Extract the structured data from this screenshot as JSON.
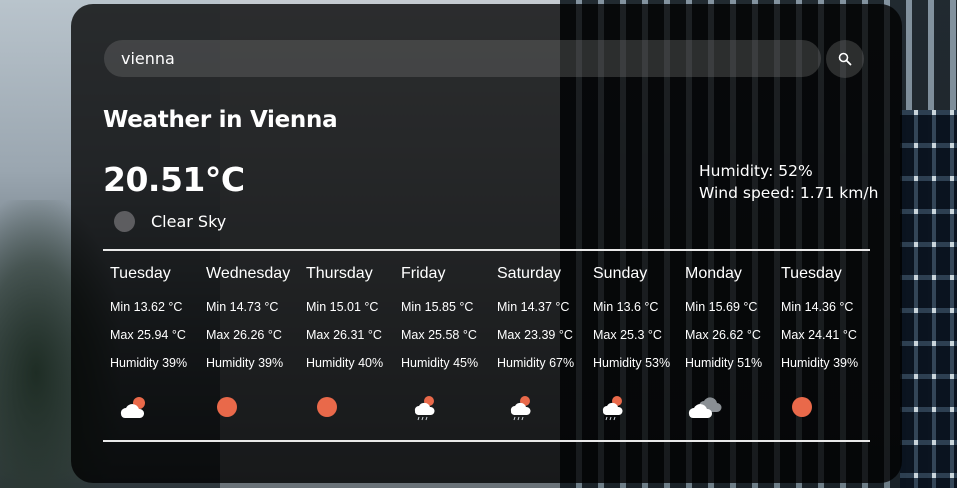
{
  "search": {
    "value": "vienna",
    "button_icon": "search-icon"
  },
  "current": {
    "title": "Weather in Vienna",
    "temperature": "20.51°C",
    "condition": "Clear Sky",
    "condition_icon": "clear-sky-icon",
    "humidity": "Humidity: 52%",
    "wind": "Wind speed: 1.71 km/h"
  },
  "colors": {
    "sun": "#e9694a",
    "cloud": "#ffffff",
    "card": "rgba(0,0,0,0.78)"
  },
  "forecast": [
    {
      "day": "Tuesday",
      "min": "Min 13.62 °C",
      "max": "Max 25.94 °C",
      "humidity": "Humidity 39%",
      "icon": "few-clouds-icon"
    },
    {
      "day": "Wednesday",
      "min": "Min 14.73 °C",
      "max": "Max 26.26 °C",
      "humidity": "Humidity 39%",
      "icon": "clear-sky-icon"
    },
    {
      "day": "Thursday",
      "min": "Min 15.01 °C",
      "max": "Max 26.31 °C",
      "humidity": "Humidity 40%",
      "icon": "clear-sky-icon"
    },
    {
      "day": "Friday",
      "min": "Min 15.85 °C",
      "max": "Max 25.58 °C",
      "humidity": "Humidity 45%",
      "icon": "rain-sun-icon"
    },
    {
      "day": "Saturday",
      "min": "Min 14.37 °C",
      "max": "Max 23.39 °C",
      "humidity": "Humidity 67%",
      "icon": "rain-sun-icon"
    },
    {
      "day": "Sunday",
      "min": "Min 13.6 °C",
      "max": "Max 25.3 °C",
      "humidity": "Humidity 53%",
      "icon": "rain-sun-icon"
    },
    {
      "day": "Monday",
      "min": "Min 15.69 °C",
      "max": "Max 26.62 °C",
      "humidity": "Humidity 51%",
      "icon": "broken-clouds-icon"
    },
    {
      "day": "Tuesday",
      "min": "Min 14.36 °C",
      "max": "Max 24.41 °C",
      "humidity": "Humidity 39%",
      "icon": "clear-sky-icon"
    }
  ]
}
